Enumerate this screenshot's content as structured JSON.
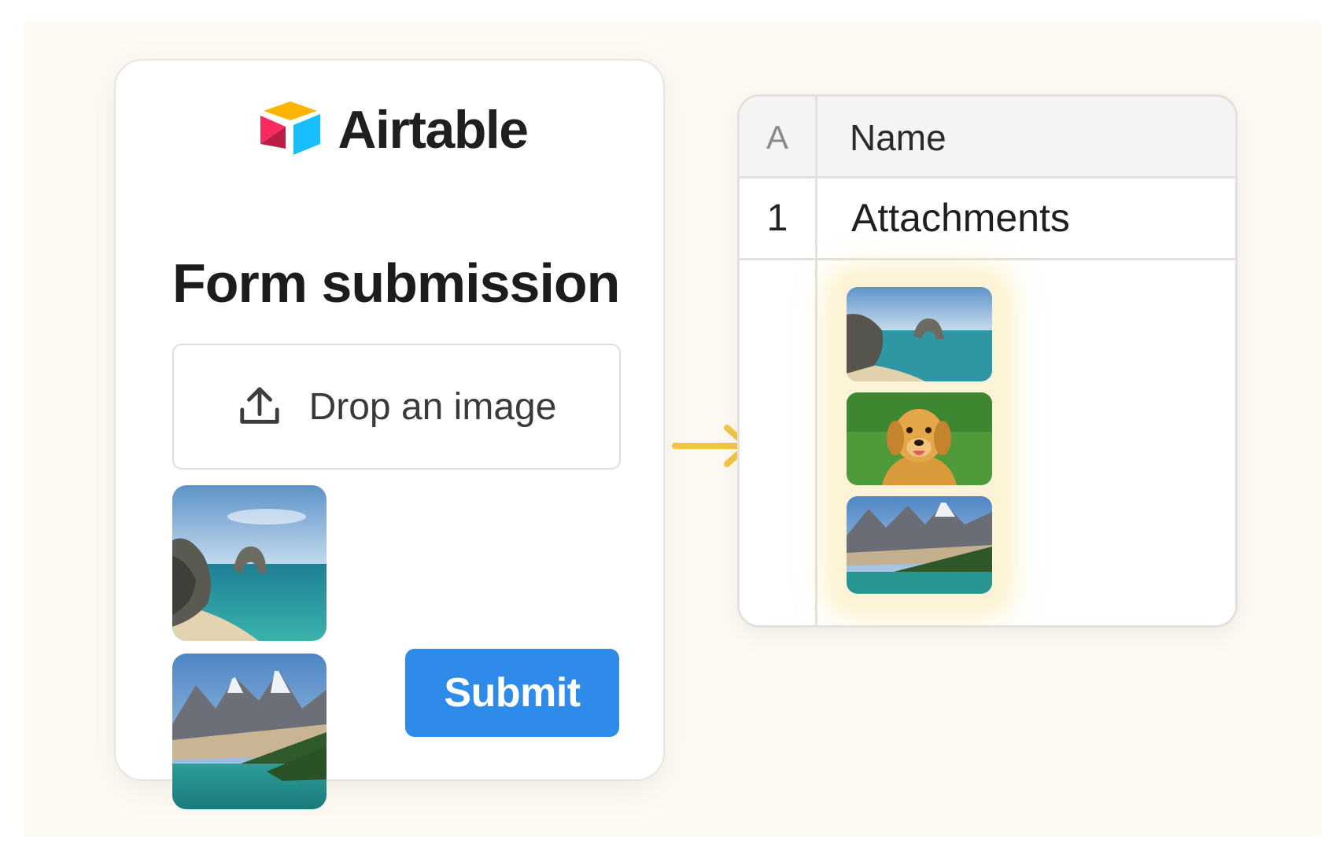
{
  "form": {
    "logo_text": "Airtable",
    "title": "Form submission",
    "dropzone_label": "Drop an image",
    "submit_label": "Submit",
    "uploaded_images": [
      "coastal-arch-image",
      "mountain-lake-image"
    ]
  },
  "table": {
    "index_header": "A",
    "name_header": "Name",
    "row_index": "1",
    "row_value": "Attachments",
    "attachments": [
      "coastal-arch-image",
      "golden-retriever-image",
      "mountain-lake-image"
    ]
  },
  "colors": {
    "brand_yellow": "#fcb400",
    "brand_red": "#f82b60",
    "brand_blue": "#18bfff",
    "submit_blue": "#2f8bea",
    "arrow_yellow": "#f2c644",
    "attachment_highlight": "#fdf3d6"
  },
  "icons": {
    "logo": "airtable-logo-icon",
    "upload": "upload-icon",
    "flow": "arrow-right-icon"
  }
}
